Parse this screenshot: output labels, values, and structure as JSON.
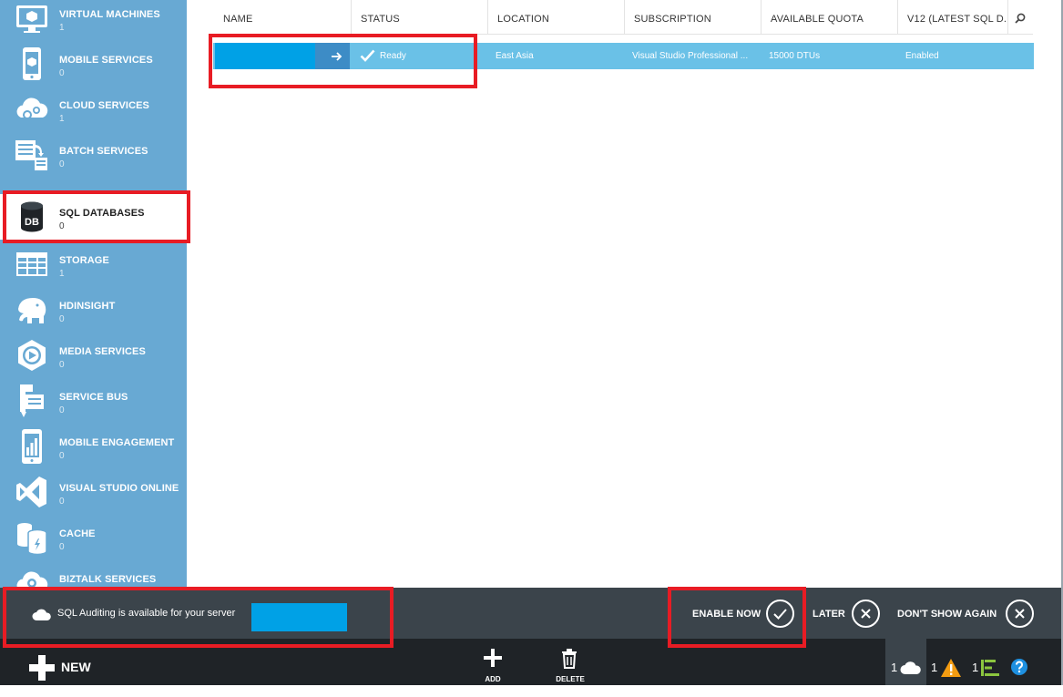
{
  "sidebar": {
    "items": [
      {
        "label": "VIRTUAL MACHINES",
        "count": "1",
        "icon": "virtual-machine-icon"
      },
      {
        "label": "MOBILE SERVICES",
        "count": "0",
        "icon": "mobile-services-icon"
      },
      {
        "label": "CLOUD SERVICES",
        "count": "1",
        "icon": "cloud-services-icon"
      },
      {
        "label": "BATCH SERVICES",
        "count": "0",
        "icon": "batch-services-icon"
      },
      {
        "label": "SQL DATABASES",
        "count": "0",
        "icon": "sql-database-icon",
        "icon_text": "DB",
        "active": true
      },
      {
        "label": "STORAGE",
        "count": "1",
        "icon": "storage-icon"
      },
      {
        "label": "HDINSIGHT",
        "count": "0",
        "icon": "hdinsight-elephant-icon"
      },
      {
        "label": "MEDIA SERVICES",
        "count": "0",
        "icon": "media-services-icon"
      },
      {
        "label": "SERVICE BUS",
        "count": "0",
        "icon": "service-bus-icon"
      },
      {
        "label": "MOBILE ENGAGEMENT",
        "count": "0",
        "icon": "mobile-engagement-icon"
      },
      {
        "label": "VISUAL STUDIO ONLINE",
        "count": "0",
        "icon": "visual-studio-icon"
      },
      {
        "label": "CACHE",
        "count": "0",
        "icon": "cache-icon"
      },
      {
        "label": "BIZTALK SERVICES",
        "count": "",
        "icon": "biztalk-icon"
      }
    ]
  },
  "grid": {
    "columns": [
      "NAME",
      "STATUS",
      "LOCATION",
      "SUBSCRIPTION",
      "AVAILABLE QUOTA",
      "V12 (LATEST SQL D..."
    ],
    "rows": [
      {
        "name": "",
        "status": "Ready",
        "location": "East Asia",
        "subscription": "Visual Studio Professional ...",
        "quota": "15000 DTUs",
        "v12": "Enabled"
      }
    ]
  },
  "notification": {
    "message": "SQL Auditing is available for your server",
    "enable_now": "ENABLE NOW",
    "later": "LATER",
    "dont_show": "DON'T SHOW AGAIN"
  },
  "commandbar": {
    "new_label": "NEW",
    "add_label": "ADD",
    "delete_label": "DELETE",
    "status_counts": [
      "1",
      "1",
      "1"
    ]
  },
  "colors": {
    "sidebar": "#68a9d3",
    "selected_row": "#6ac1e7",
    "notification_bar": "#3b444b",
    "command_bar": "#1f2327",
    "highlight": "#e81c24",
    "redaction": "#00a1e6",
    "warning": "#f39c12",
    "help": "#1e90e0"
  }
}
